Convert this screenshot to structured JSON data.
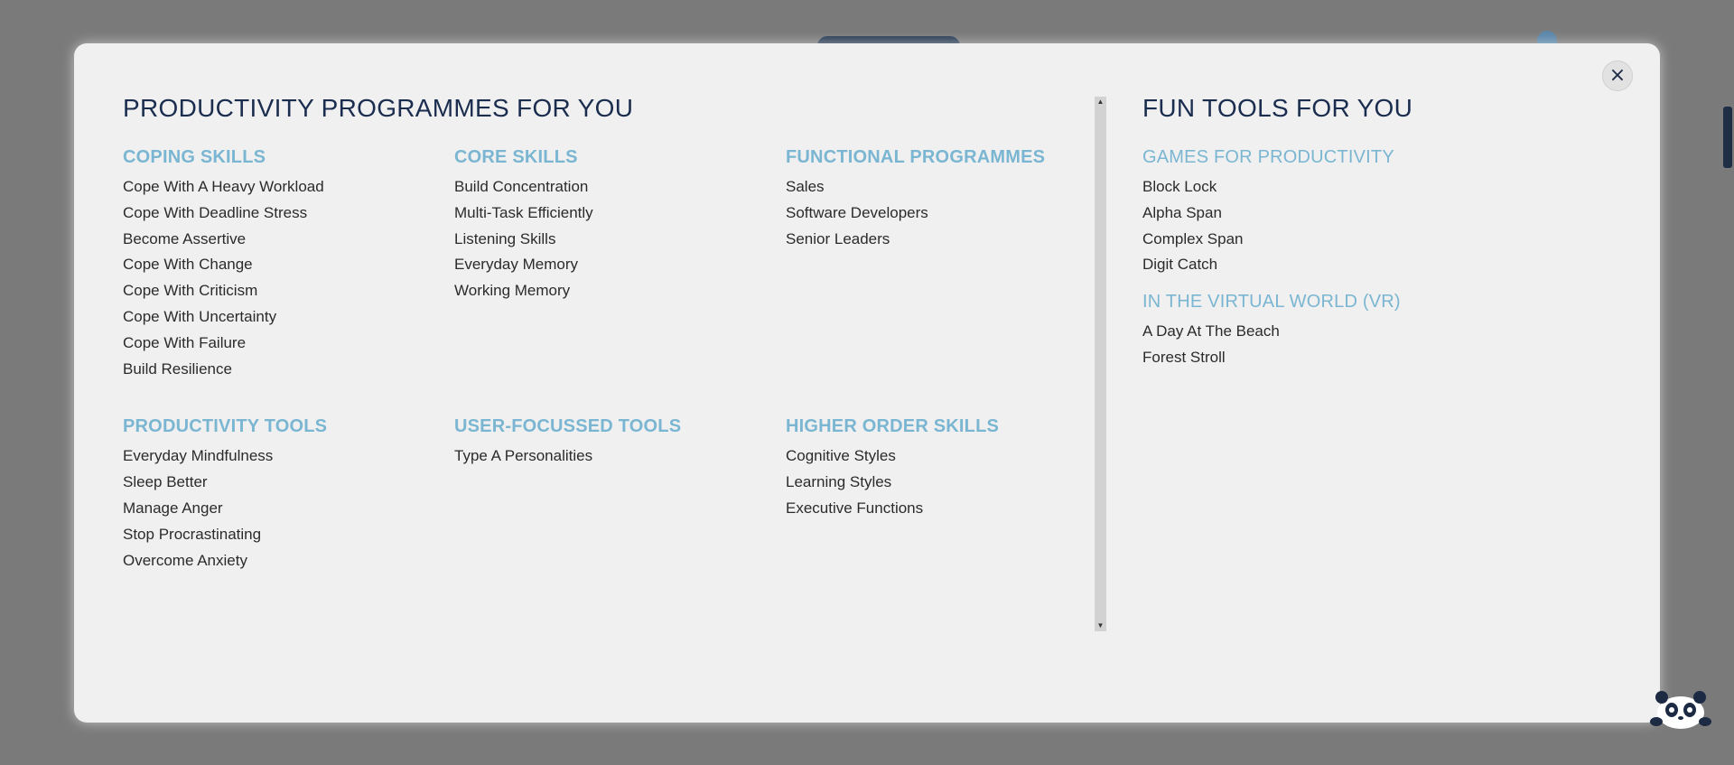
{
  "close_label": "×",
  "productivity": {
    "title": "PRODUCTIVITY PROGRAMMES FOR YOU",
    "sections": [
      {
        "heading": "COPING SKILLS",
        "items": [
          "Cope With A Heavy Workload",
          "Cope With Deadline Stress",
          "Become Assertive",
          "Cope With Change",
          "Cope With Criticism",
          "Cope With Uncertainty",
          "Cope With Failure",
          "Build Resilience"
        ]
      },
      {
        "heading": "CORE SKILLS",
        "items": [
          "Build Concentration",
          "Multi-Task Efficiently",
          "Listening Skills",
          "Everyday Memory",
          "Working Memory"
        ]
      },
      {
        "heading": "FUNCTIONAL PROGRAMMES",
        "items": [
          "Sales",
          "Software Developers",
          "Senior Leaders"
        ]
      },
      {
        "heading": "PRODUCTIVITY TOOLS",
        "items": [
          "Everyday Mindfulness",
          "Sleep Better",
          "Manage Anger",
          "Stop Procrastinating",
          "Overcome Anxiety"
        ]
      },
      {
        "heading": "USER-FOCUSSED TOOLS",
        "items": [
          "Type A Personalities"
        ]
      },
      {
        "heading": "HIGHER ORDER SKILLS",
        "items": [
          "Cognitive Styles",
          "Learning Styles",
          "Executive Functions"
        ]
      }
    ]
  },
  "fun_tools": {
    "title": "FUN TOOLS FOR YOU",
    "sections": [
      {
        "heading": "GAMES FOR PRODUCTIVITY",
        "items": [
          "Block Lock",
          "Alpha Span",
          "Complex Span",
          "Digit Catch"
        ]
      },
      {
        "heading": "IN THE VIRTUAL WORLD (VR)",
        "items": [
          "A Day At The Beach",
          "Forest Stroll"
        ]
      }
    ]
  },
  "icons": {
    "close": "close-icon",
    "mascot": "panda-icon",
    "scroll_up": "scroll-up-icon",
    "scroll_down": "scroll-down-icon"
  },
  "colors": {
    "heading": "#7ab6d2",
    "title": "#1b2d4f",
    "modal_bg": "#f0f0f0",
    "overlay": "#7a7a7a"
  }
}
